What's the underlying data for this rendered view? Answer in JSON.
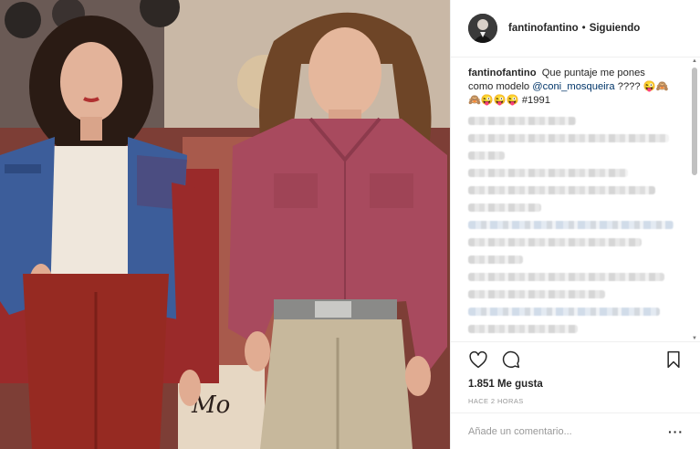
{
  "post": {
    "username": "fantinofantino",
    "follow_status": "Siguiendo",
    "caption_username": "fantinofantino",
    "caption_text_1": "Que puntaje me pones como modelo",
    "caption_mention": "@coni_mosqueira",
    "caption_text_2": "???? 😜🙈 🙈😜😜😜 #1991",
    "likes": "1.851 Me gusta",
    "time_ago": "HACE 2 HORAS",
    "comment_placeholder": "Añade un comentario...",
    "more_options": "···"
  },
  "icons": {
    "like": "heart-icon",
    "comment": "comment-bubble-icon",
    "save": "bookmark-icon",
    "more": "ellipsis-icon"
  },
  "colors": {
    "mention": "#003569",
    "border": "#efefef",
    "muted": "#999999"
  }
}
